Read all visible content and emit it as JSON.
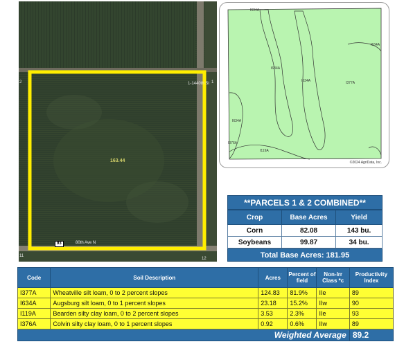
{
  "aerial": {
    "acres_label": "163.44",
    "road_label": "80th Ave N",
    "road_shield": "93",
    "hwy_label": "1-1440th St",
    "section_labels": [
      "2",
      "1",
      "11",
      "12"
    ]
  },
  "soil_map": {
    "labels": [
      "I634A",
      "I634A",
      "I634A",
      "I634A",
      "I377A",
      "I634A",
      "I376A",
      "I119A"
    ],
    "copyright": "©2024 AgriData, Inc."
  },
  "parcels": {
    "banner": "**PARCELS 1 & 2 COMBINED**",
    "headers": [
      "Crop",
      "Base Acres",
      "Yield"
    ],
    "rows": [
      {
        "crop": "Corn",
        "base_acres": "82.08",
        "yield": "143 bu."
      },
      {
        "crop": "Soybeans",
        "base_acres": "99.87",
        "yield": "34 bu."
      }
    ],
    "total_label": "Total Base Acres:",
    "total_value": "181.95"
  },
  "soils": {
    "headers": {
      "code": "Code",
      "description": "Soil Description",
      "acres": "Acres",
      "percent": "Percent of field",
      "class": "Non-Irr Class *c",
      "index": "Productivity Index"
    },
    "rows": [
      {
        "code": "I377A",
        "description": "Wheatville silt loam, 0 to 2 percent slopes",
        "acres": "124.83",
        "percent": "81.9%",
        "class": "IIe",
        "index": "89"
      },
      {
        "code": "I634A",
        "description": "Augsburg silt loam, 0 to 1 percent slopes",
        "acres": "23.18",
        "percent": "15.2%",
        "class": "IIw",
        "index": "90"
      },
      {
        "code": "I119A",
        "description": "Bearden silty clay loam, 0 to 2 percent slopes",
        "acres": "3.53",
        "percent": "2.3%",
        "class": "IIe",
        "index": "93"
      },
      {
        "code": "I376A",
        "description": "Colvin silty clay loam, 0 to 1 percent slopes",
        "acres": "0.92",
        "percent": "0.6%",
        "class": "IIw",
        "index": "89"
      }
    ],
    "weighted_label": "Weighted Average",
    "weighted_value": "89.2"
  },
  "colors": {
    "header_blue": "#2e6ea6",
    "row_yellow": "#ffff33",
    "boundary_yellow": "#ffee00",
    "soil_green": "#b9f4b0"
  }
}
